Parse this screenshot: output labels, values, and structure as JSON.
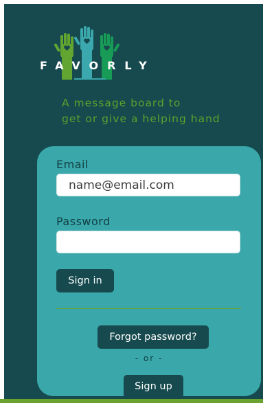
{
  "brand": {
    "name": "FAVORLY",
    "tagline_line1": "A message board to",
    "tagline_line2": "get or give a helping hand"
  },
  "form": {
    "email_label": "Email",
    "email_placeholder": "name@email.com",
    "email_value": "",
    "password_label": "Password",
    "password_placeholder": "",
    "password_value": "",
    "signin_label": "Sign in",
    "forgot_label": "Forgot password?",
    "or_text": "- or -",
    "signup_label": "Sign up"
  },
  "colors": {
    "background": "#164a4e",
    "card": "#3aa8ab",
    "accent_green": "#6aa12f",
    "button": "#164a4e",
    "hand_left": "#62a530",
    "hand_center": "#3aa8ac",
    "hand_right": "#189b56"
  },
  "icons": {
    "logo": "helping-hands-logo-icon"
  }
}
